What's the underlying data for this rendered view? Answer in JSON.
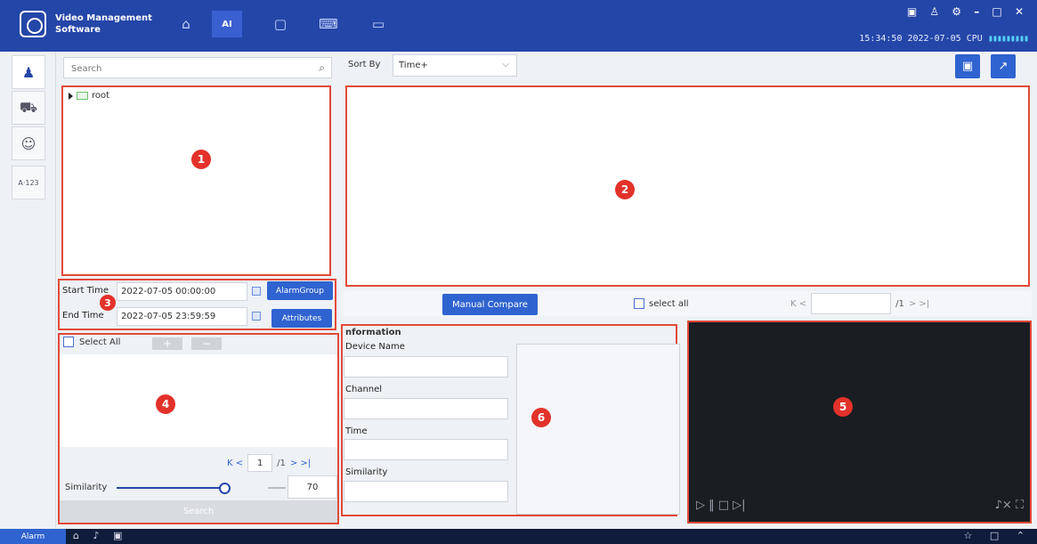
{
  "app": {
    "title_line1": "Video Management",
    "title_line2": "Software"
  },
  "window": {
    "controls": "▣ ♙ ⚙ – □ ✕",
    "clock": "15:34:50 2022-07-05",
    "cpu_label": "CPU"
  },
  "nav": [
    {
      "name": "home",
      "glyph": "⌂"
    },
    {
      "name": "ai",
      "glyph": "AI"
    },
    {
      "name": "camera",
      "glyph": "▢"
    },
    {
      "name": "keyboard",
      "glyph": "⌨"
    },
    {
      "name": "display",
      "glyph": "▭"
    }
  ],
  "rail": [
    {
      "name": "person",
      "glyph": "♟"
    },
    {
      "name": "vehicle",
      "glyph": "⛟"
    },
    {
      "name": "face",
      "glyph": "☺"
    },
    {
      "name": "plate",
      "glyph": "A·123"
    }
  ],
  "search": {
    "placeholder": "Search",
    "icon": "⌕"
  },
  "tree": {
    "root_label": "root"
  },
  "sort": {
    "label": "Sort By",
    "value": "Time+",
    "chevron": "⌵"
  },
  "top_buttons": {
    "save": "▣",
    "export": "↗"
  },
  "time": {
    "start_label": "Start Time",
    "start_value": "2022-07-05 00:00:00",
    "end_label": "End Time",
    "end_value": "2022-07-05 23:59:59",
    "alarm_group_label": "AlarmGroup",
    "attributes_label": "Attributes"
  },
  "compare": {
    "button_label": "Manual Compare",
    "select_all_label": "select all",
    "page_total": "/1",
    "nav_first_prev": "K <",
    "nav_next_last": "> >|"
  },
  "targets": {
    "select_all_label": "Select All",
    "add_label": "+",
    "remove_label": "−",
    "page_value": "1",
    "page_total": "/1",
    "nav_first_prev": "K <",
    "nav_next_last": "> >|",
    "similarity_label": "Similarity",
    "similarity_value": "70",
    "similarity_fraction": 0.72,
    "search_label": "Search"
  },
  "info": {
    "header": "nformation",
    "fields": [
      "Device Name",
      "Channel",
      "Time",
      "Similarity"
    ]
  },
  "video": {
    "controls_left": "▷  ‖  □  ▷|",
    "controls_right": "♪×  ⛶"
  },
  "status": {
    "alarm_label": "Alarm",
    "icons_left": "⌂ ♪ ▣",
    "icons_right": "☆ □ ⌃"
  },
  "markers": [
    "1",
    "2",
    "3",
    "4",
    "5",
    "6"
  ],
  "colors": {
    "title_bar": "#2446a8",
    "accent": "#2f63d0",
    "highlight_border": "#e2493a",
    "marker": "#e2322a",
    "video_bg": "#1a1d22"
  }
}
